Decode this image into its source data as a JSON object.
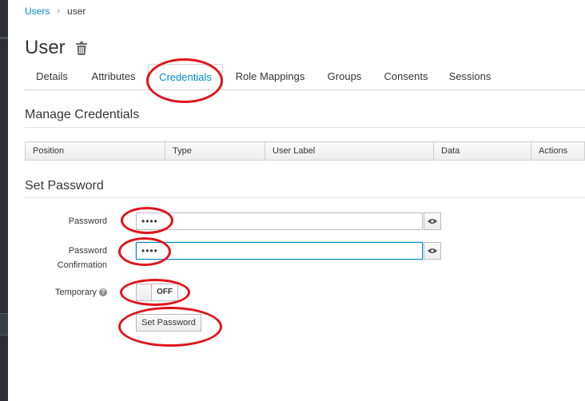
{
  "breadcrumb": {
    "parent": "Users",
    "separator": "›",
    "current": "user"
  },
  "page": {
    "title": "User"
  },
  "tabs": [
    {
      "label": "Details"
    },
    {
      "label": "Attributes"
    },
    {
      "label": "Credentials",
      "active": true
    },
    {
      "label": "Role Mappings"
    },
    {
      "label": "Groups"
    },
    {
      "label": "Consents"
    },
    {
      "label": "Sessions"
    }
  ],
  "manage_credentials": {
    "title": "Manage Credentials",
    "columns": [
      "Position",
      "Type",
      "User Label",
      "Data",
      "Actions"
    ]
  },
  "set_password": {
    "title": "Set Password",
    "password_label": "Password",
    "password_value": "••••",
    "confirmation_label_line1": "Password",
    "confirmation_label_line2": "Confirmation",
    "confirmation_value": "••••",
    "temporary_label": "Temporary",
    "temporary_state": "OFF",
    "submit_label": "Set Password"
  },
  "colors": {
    "accent": "#0088ce",
    "annotation": "#e0141c"
  },
  "icons": {
    "delete": "trash-icon",
    "reveal": "eye-icon",
    "help": "question-circle-icon",
    "breadcrumb_sep": "chevron-right-icon"
  }
}
